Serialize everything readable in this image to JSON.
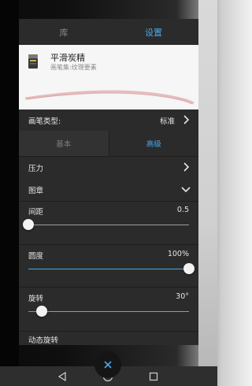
{
  "tabs": {
    "library": "库",
    "settings": "设置"
  },
  "brush": {
    "name": "平滑炭精",
    "subtitle": "画笔集:纹理要素"
  },
  "brush_type": {
    "label": "画笔类型:",
    "value": "标准"
  },
  "mode_tabs": {
    "basic": "基本",
    "advanced": "高级"
  },
  "sections": {
    "pressure": "压力",
    "stamp": "图章",
    "dynamic_rotation": "动态旋转"
  },
  "sliders": {
    "spacing": {
      "label": "间距",
      "value_text": "0.5",
      "fraction": 0.0
    },
    "roundness": {
      "label": "圆度",
      "value_text": "100%",
      "fraction": 1.0
    },
    "rotation": {
      "label": "旋转",
      "value_text": "30°",
      "fraction": 0.083
    }
  },
  "colors": {
    "accent": "#4aa8e8",
    "panel": "#2b2b2b"
  },
  "icons": {
    "close": "close-icon",
    "back": "back-triangle-icon",
    "home": "home-circle-icon",
    "recents": "recents-square-icon"
  }
}
